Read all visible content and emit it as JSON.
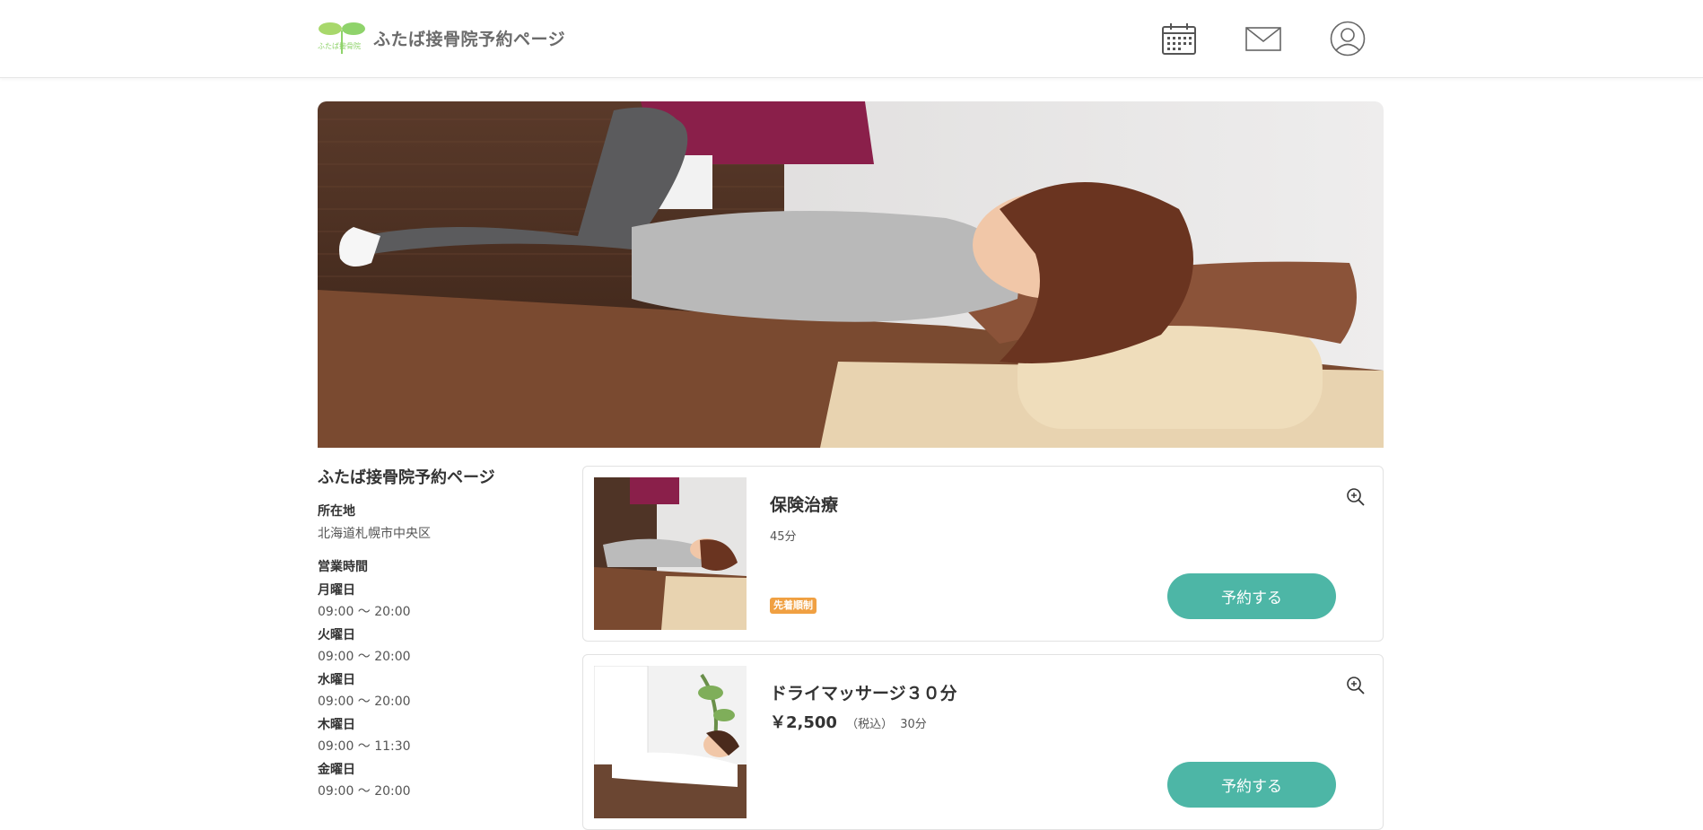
{
  "header": {
    "site_title": "ふたば接骨院予約ページ",
    "logo_text": "ふたば接骨院",
    "icons": [
      "calendar-icon",
      "mail-icon",
      "user-icon"
    ]
  },
  "info": {
    "title": "ふたば接骨院予約ページ",
    "location_label": "所在地",
    "location_value": "北海道札幌市中央区",
    "hours_label": "営業時間",
    "schedule": [
      {
        "day": "月曜日",
        "hours": "09:00 〜 20:00"
      },
      {
        "day": "火曜日",
        "hours": "09:00 〜 20:00"
      },
      {
        "day": "水曜日",
        "hours": "09:00 〜 20:00"
      },
      {
        "day": "木曜日",
        "hours": "09:00 〜 11:30"
      },
      {
        "day": "金曜日",
        "hours": "09:00 〜 20:00"
      }
    ]
  },
  "menus": [
    {
      "title": "保険治療",
      "duration": "45分",
      "tag": "先着順制",
      "reserve_label": "予約する"
    },
    {
      "title": "ドライマッサージ３０分",
      "price": "￥2,500",
      "tax_note": "（税込）",
      "duration": "30分",
      "reserve_label": "予約する"
    }
  ],
  "colors": {
    "accent": "#4db6a6",
    "tag": "#f0a042",
    "logo_green": "#8fd36b"
  }
}
